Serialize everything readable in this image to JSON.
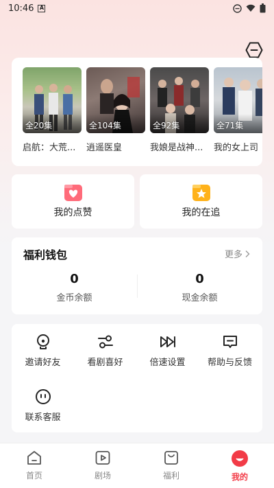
{
  "status_bar": {
    "time": "10:46"
  },
  "history": [
    {
      "episodes": "全20集",
      "title": "启航：大荒..."
    },
    {
      "episodes": "全104集",
      "title": "逍遥医皇"
    },
    {
      "episodes": "全92集",
      "title": "我娘是战神..."
    },
    {
      "episodes": "全71集",
      "title": "我的女上司"
    }
  ],
  "favorites": {
    "likes_label": "我的点赞",
    "following_label": "我的在追"
  },
  "wallet": {
    "title": "福利钱包",
    "more_label": "更多",
    "coins_value": "0",
    "coins_label": "金币余额",
    "cash_value": "0",
    "cash_label": "现金余额"
  },
  "tools": {
    "invite": "邀请好友",
    "preferences": "看剧喜好",
    "speed": "倍速设置",
    "help": "帮助与反馈",
    "service": "联系客服"
  },
  "tabbar": {
    "home": "首页",
    "theater": "剧场",
    "welfare": "福利",
    "mine": "我的",
    "active_color": "#f23b47"
  }
}
